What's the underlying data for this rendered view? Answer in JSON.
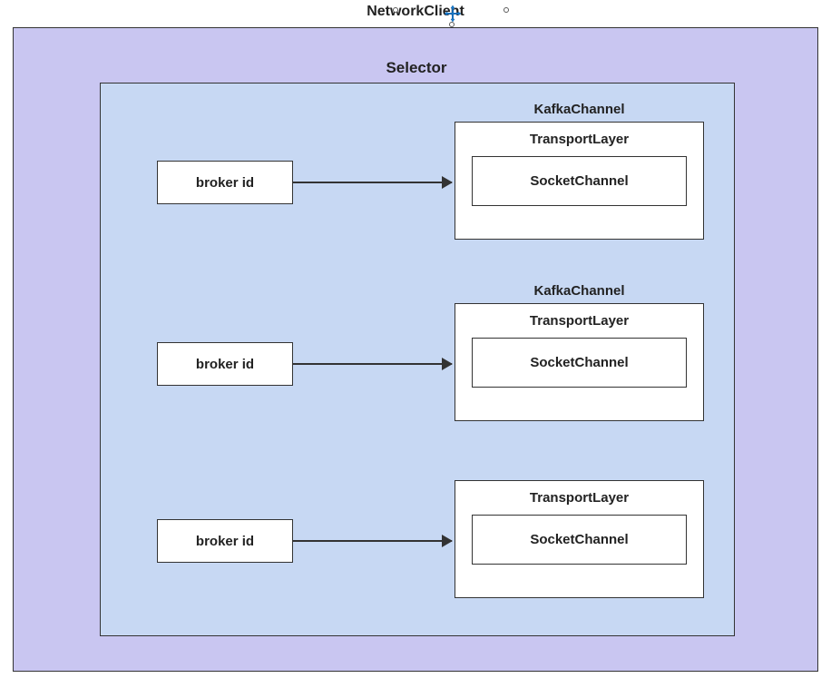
{
  "title": "NetworkClient",
  "selector": {
    "title": "Selector",
    "rows": [
      {
        "broker_label": "broker id",
        "kafka_channel_label": "KafkaChannel",
        "transport_label": "TransportLayer",
        "socket_label": "SocketChannel",
        "show_kafka_label": true
      },
      {
        "broker_label": "broker id",
        "kafka_channel_label": "KafkaChannel",
        "transport_label": "TransportLayer",
        "socket_label": "SocketChannel",
        "show_kafka_label": true
      },
      {
        "broker_label": "broker id",
        "kafka_channel_label": "",
        "transport_label": "TransportLayer",
        "socket_label": "SocketChannel",
        "show_kafka_label": false
      }
    ]
  }
}
